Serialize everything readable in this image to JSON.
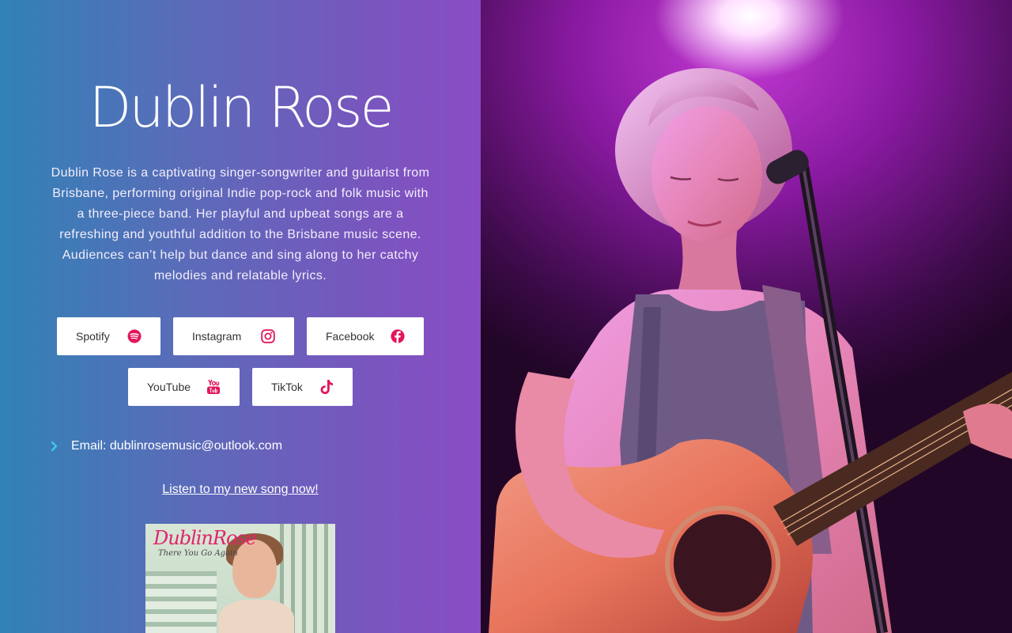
{
  "hero": {
    "title": "Dublin Rose",
    "bio": "Dublin Rose is a captivating singer-songwriter and guitarist from Brisbane, performing original Indie pop-rock and folk music with a three-piece band. Her playful and upbeat songs are a refreshing and youthful addition to the Brisbane music scene. Audiences can’t help but dance and sing along to her catchy melodies and relatable lyrics."
  },
  "social": [
    {
      "label": "Spotify",
      "icon": "spotify-icon"
    },
    {
      "label": "Instagram",
      "icon": "instagram-icon"
    },
    {
      "label": "Facebook",
      "icon": "facebook-icon"
    },
    {
      "label": "YouTube",
      "icon": "youtube-icon"
    },
    {
      "label": "TikTok",
      "icon": "tiktok-icon"
    }
  ],
  "contact": {
    "email_text": "Email: dublinrosemusic@outlook.com"
  },
  "promo": {
    "link_text": "Listen to my new song now!",
    "cover_brand": "DublinRose",
    "cover_subtitle": "There You Go Again"
  },
  "colors": {
    "accent": "#e2165b",
    "chevron": "#42c5f0",
    "gradient_start": "#3182b6",
    "gradient_end": "#8a4cc4"
  }
}
